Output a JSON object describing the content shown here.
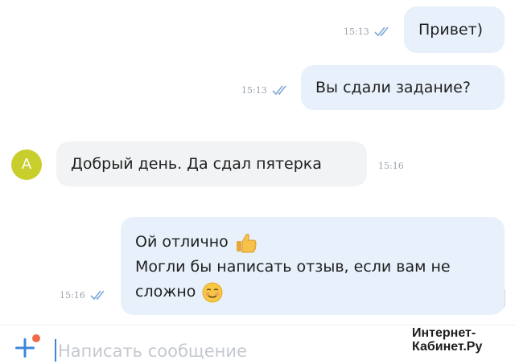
{
  "messages": [
    {
      "text": "Привет)",
      "time": "15:13"
    },
    {
      "text": "Вы сдали задание?",
      "time": "15:13"
    },
    {
      "text": "Добрый день. Да сдал пятерка",
      "time": "15:16",
      "avatar_letter": "А"
    },
    {
      "lines": [
        "Ой отлично",
        "Могли бы написать отзыв, если вам не",
        "сложно"
      ],
      "time": "15:16"
    }
  ],
  "composer": {
    "placeholder": "Написать сообщение"
  },
  "watermark": [
    "Интернет-",
    "Кабинет.Ру"
  ],
  "colors": {
    "outgoing_bubble": "#e8f1fb",
    "incoming_bubble": "#f2f3f5",
    "avatar": "#c8cf2d",
    "read_ticks": "#7fa9d9",
    "accent": "#3d86d9"
  }
}
